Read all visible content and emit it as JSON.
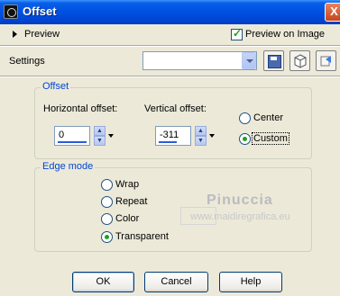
{
  "window": {
    "title": "Offset",
    "close_glyph": "X"
  },
  "preview": {
    "label": "Preview",
    "preview_on_image_label": "Preview on Image",
    "preview_on_image_checked": true
  },
  "settings": {
    "label": "Settings",
    "preset_value": "",
    "toolbar_icons": [
      "save-preset-icon",
      "cube-icon",
      "restore-icon"
    ]
  },
  "offset_group": {
    "legend": "Offset",
    "horizontal_label": "Horizontal offset:",
    "horizontal_value": "0",
    "vertical_label": "Vertical offset:",
    "vertical_value": "-311",
    "center_label": "Center",
    "custom_label": "Custom",
    "selected": "Custom"
  },
  "edge_mode_group": {
    "legend": "Edge mode",
    "options": [
      "Wrap",
      "Repeat",
      "Color",
      "Transparent"
    ],
    "selected": "Transparent"
  },
  "buttons": {
    "ok": "OK",
    "cancel": "Cancel",
    "help": "Help"
  },
  "watermark": {
    "name": "Pinuccia",
    "url": "www.maidiregrafica.eu"
  },
  "colors": {
    "titlebar_blue": "#0054e3",
    "legend_blue": "#0046d5",
    "check_green": "#21a121",
    "dialog_bg": "#ece9d8"
  }
}
